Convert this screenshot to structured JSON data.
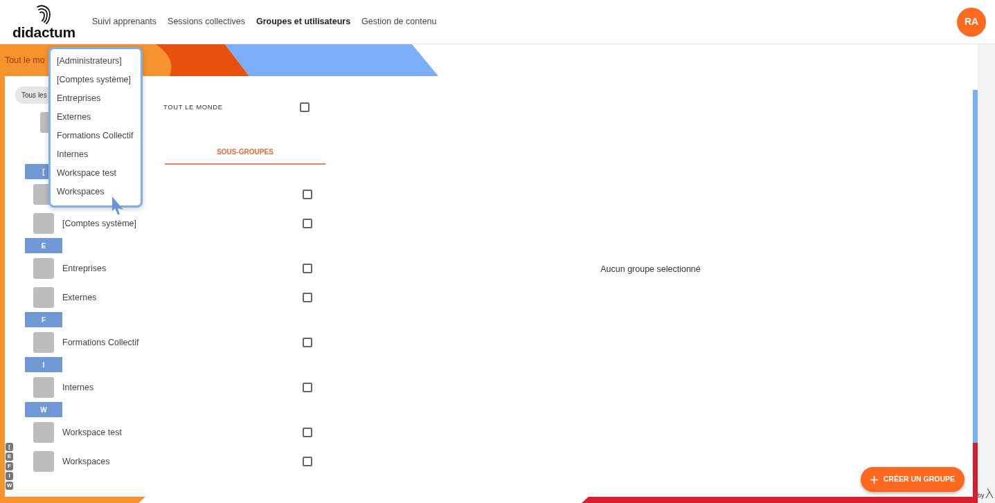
{
  "header": {
    "logo": "didactum",
    "nav": [
      {
        "label": "Suivi apprenants",
        "selected": false
      },
      {
        "label": "Sessions collectives",
        "selected": false
      },
      {
        "label": "Groupes et utilisateurs",
        "selected": true
      },
      {
        "label": "Gestion de contenu",
        "selected": false
      }
    ],
    "avatar": "RA"
  },
  "breadcrumb": "Tout le mo",
  "filter_chip": "Tous les",
  "everyone": {
    "label": "TOUT LE MONDE",
    "checked": false
  },
  "tabs": [
    {
      "label": "SOUS-GROUPES",
      "selected": true
    }
  ],
  "groups": [
    {
      "letter": "[",
      "items": [
        {
          "checked": false
        },
        {
          "name": "[Comptes système]",
          "checked": false
        }
      ]
    },
    {
      "letter": "E",
      "items": [
        {
          "name": "Entreprises",
          "checked": false
        },
        {
          "name": "Externes",
          "checked": false
        }
      ]
    },
    {
      "letter": "F",
      "items": [
        {
          "name": "Formations Collectif",
          "checked": false
        }
      ]
    },
    {
      "letter": "I",
      "items": [
        {
          "name": "Internes",
          "checked": false
        }
      ]
    },
    {
      "letter": "W",
      "items": [
        {
          "name": "Workspace test",
          "checked": false
        },
        {
          "name": "Workspaces",
          "checked": false
        }
      ]
    }
  ],
  "letter_index": [
    "[",
    "E",
    "F",
    "I",
    "W"
  ],
  "dropdown": {
    "items": [
      "[Administrateurs]",
      "[Comptes système]",
      "Entreprises",
      "Externes",
      "Formations Collectif",
      "Internes",
      "Workspace test",
      "Workspaces"
    ]
  },
  "detail": {
    "empty_message": "Aucun groupe selectionné"
  },
  "create_button": {
    "label": "CRÉER UN GROUPE"
  },
  "footer_credit": "by"
}
